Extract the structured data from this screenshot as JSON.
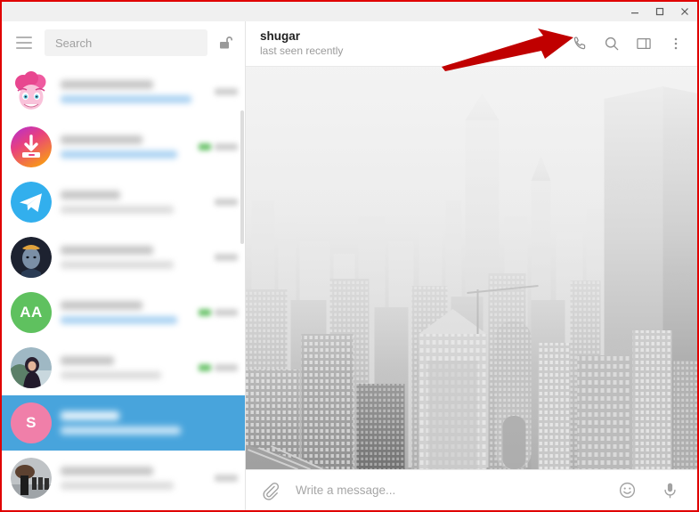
{
  "window": {
    "controls": [
      {
        "name": "minimize",
        "glyph": "minimize-icon"
      },
      {
        "name": "maximize",
        "glyph": "maximize-icon"
      },
      {
        "name": "close",
        "glyph": "close-icon"
      }
    ]
  },
  "sidebar": {
    "menu_icon": "hamburger-menu-icon",
    "search": {
      "placeholder": "Search",
      "value": ""
    },
    "lock_icon": "unlocked-padlock-icon",
    "chats": [
      {
        "avatar_type": "image",
        "avatar_label": "",
        "avatar_desc": "pink-cartoon-pony-avatar",
        "selected": false,
        "preview_is_link": true,
        "has_tick": false
      },
      {
        "avatar_type": "image",
        "avatar_label": "",
        "avatar_desc": "download-arrow-gradient-avatar",
        "selected": false,
        "preview_is_link": true,
        "has_tick": true
      },
      {
        "avatar_type": "image",
        "avatar_label": "",
        "avatar_desc": "telegram-logo-avatar",
        "selected": false,
        "preview_is_link": false,
        "has_tick": false
      },
      {
        "avatar_type": "image",
        "avatar_label": "",
        "avatar_desc": "dark-portrait-avatar",
        "selected": false,
        "preview_is_link": false,
        "has_tick": false
      },
      {
        "avatar_type": "initials",
        "avatar_label": "AA",
        "avatar_desc": "green-initials-avatar",
        "selected": false,
        "preview_is_link": true,
        "has_tick": true
      },
      {
        "avatar_type": "image",
        "avatar_label": "",
        "avatar_desc": "woman-photo-avatar",
        "selected": false,
        "preview_is_link": false,
        "has_tick": true
      },
      {
        "avatar_type": "initials",
        "avatar_label": "S",
        "avatar_desc": "pink-initials-avatar",
        "selected": true,
        "preview_is_link": false,
        "has_tick": false
      },
      {
        "avatar_type": "image",
        "avatar_label": "",
        "avatar_desc": "group-photo-avatar",
        "selected": false,
        "preview_is_link": false,
        "has_tick": false
      }
    ]
  },
  "chat": {
    "peer_name": "shugar",
    "peer_status": "last seen recently",
    "actions": [
      {
        "name": "call-button",
        "icon": "phone-icon"
      },
      {
        "name": "search-in-chat-button",
        "icon": "search-icon"
      },
      {
        "name": "toggle-info-panel-button",
        "icon": "panel-right-icon"
      },
      {
        "name": "more-menu-button",
        "icon": "dots-vertical-icon"
      }
    ],
    "wallpaper_desc": "grayscale-city-skyline-wallpaper"
  },
  "composer": {
    "attach_icon": "paperclip-icon",
    "placeholder": "Write a message...",
    "value": "",
    "emoji_icon": "smiley-icon",
    "mic_icon": "microphone-icon"
  },
  "annotation": {
    "arrow": "red-arrow-pointing-to-call-button",
    "color": "#c00000"
  },
  "colors": {
    "accent": "#48a4dc",
    "titlebar": "#f0f0f0",
    "border_highlight": "#e00000",
    "avatar_green": "#5fc15f",
    "avatar_pink": "#f07fa9"
  }
}
